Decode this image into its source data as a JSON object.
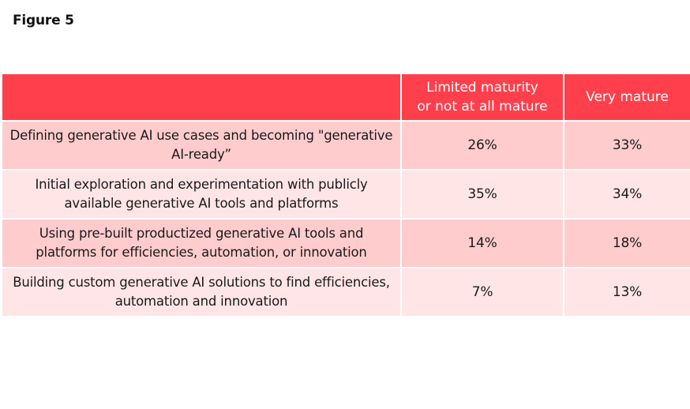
{
  "figure_title": "Figure 5",
  "table": {
    "headers": [
      "",
      "Limited maturity\nor not at all mature",
      "Very mature"
    ],
    "rows": [
      {
        "label": "Defining generative AI use cases and becoming \"generative AI-ready”",
        "limited": "26%",
        "very": "33%"
      },
      {
        "label": "Initial exploration and experimentation with publicly available generative AI tools and platforms",
        "limited": "35%",
        "very": "34%"
      },
      {
        "label": "Using pre-built productized generative AI tools and platforms for efficiencies, automation, or innovation",
        "limited": "14%",
        "very": "18%"
      },
      {
        "label": "Building custom generative AI solutions to find efficiencies, automation and innovation",
        "limited": "7%",
        "very": "13%"
      }
    ]
  },
  "colors": {
    "header_bg": "#ff3f4c",
    "row_dark": "#ffcccd",
    "row_light": "#ffe5e6"
  }
}
